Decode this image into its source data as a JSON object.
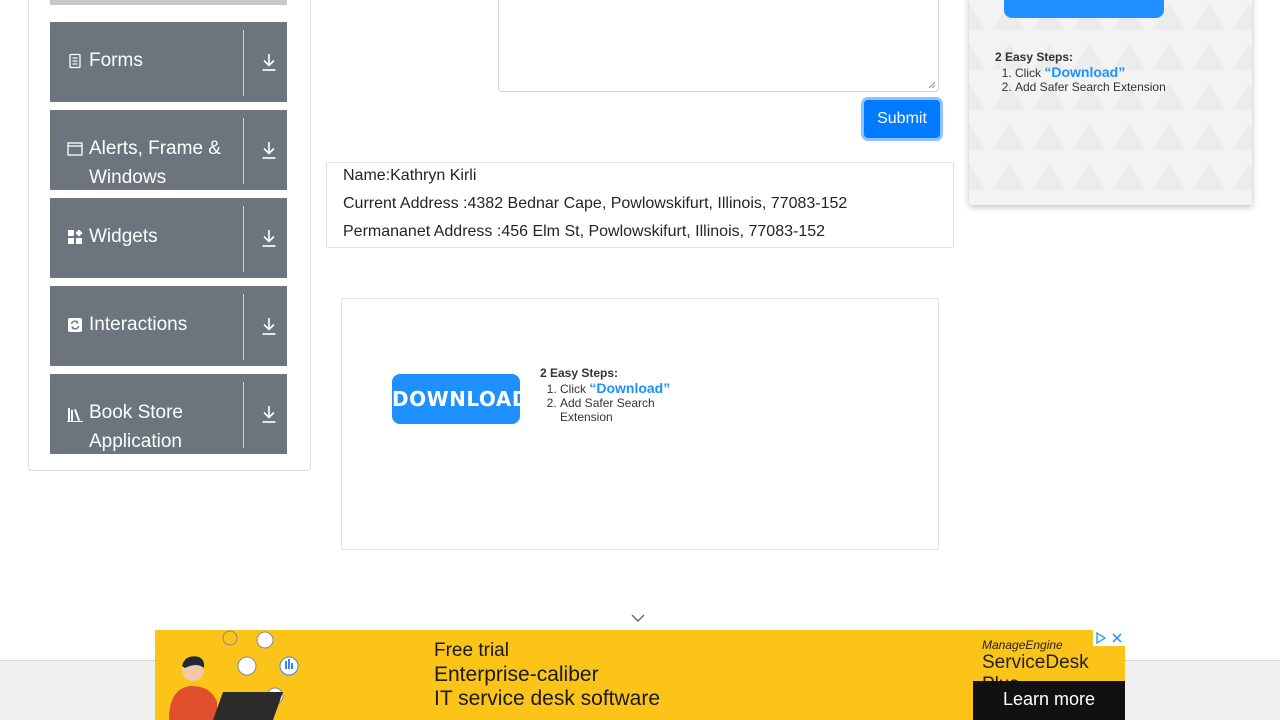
{
  "sidebar": {
    "groups": [
      {
        "label": "Forms",
        "icon": "forms-icon"
      },
      {
        "label": "Alerts, Frame & Windows",
        "icon": "window-icon"
      },
      {
        "label": "Widgets",
        "icon": "widgets-icon"
      },
      {
        "label": "Interactions",
        "icon": "interactions-icon"
      },
      {
        "label": "Book Store Application",
        "icon": "book-icon"
      }
    ]
  },
  "form": {
    "submit_label": "Submit"
  },
  "output": {
    "name": "Name:Kathryn Kirli",
    "current_address": "Current Address :4382 Bednar Cape, Powlowskifurt, Illinois, 77083-152",
    "permanent_address": "Permananet Address :456 Elm St, Powlowskifurt, Illinois, 77083-152"
  },
  "ad_center": {
    "button_label": "DOWNLOAD",
    "heading": "2 Easy Steps:",
    "step1_prefix": "Click ",
    "step1_link": "“Download”",
    "step2": "Add Safer Search Extension"
  },
  "ad_right": {
    "heading": "2 Easy Steps:",
    "step1_prefix": "Click ",
    "step1_link": "“Download”",
    "step2": "Add Safer Search Extension"
  },
  "banner": {
    "line1": "Free trial",
    "line2": "Enterprise-caliber",
    "line3": "IT service desk software",
    "brand_top": "ManageEngine",
    "brand_name": "ServiceDesk Plus",
    "cta": "Learn more"
  },
  "colors": {
    "sidebar_group_bg": "#6c757d",
    "primary": "#007bff",
    "ad_blue": "#1e90ff",
    "banner_bg": "#fcc419"
  }
}
